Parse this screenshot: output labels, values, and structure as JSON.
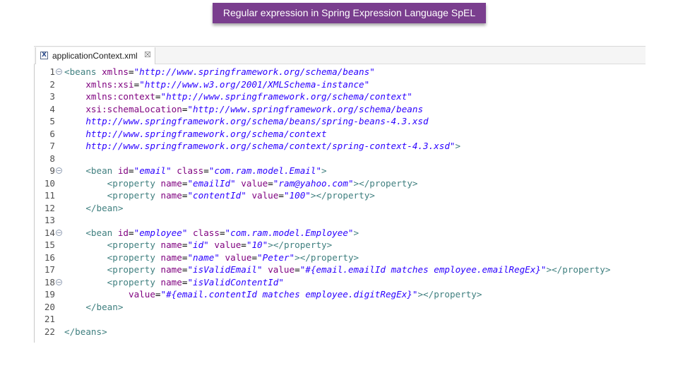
{
  "banner": {
    "title": "Regular expression in Spring Expression Language SpEL"
  },
  "tab": {
    "label": "applicationContext.xml",
    "close": "☒",
    "file_icon": "xml-file-icon"
  },
  "colors": {
    "banner": "#7a3e8e",
    "tag": "#3f7f7f",
    "attr": "#7f007f",
    "value": "#2a00ff"
  },
  "lines": [
    {
      "n": "1",
      "fold": true,
      "tokens": [
        {
          "c": "tag",
          "t": "<beans "
        },
        {
          "c": "attr",
          "t": "xmlns"
        },
        {
          "c": "eq",
          "t": "="
        },
        {
          "c": "val",
          "t": "\"http://www.springframework.org/schema/beans\""
        }
      ]
    },
    {
      "n": "2",
      "tokens": [
        {
          "c": "eq",
          "t": "    "
        },
        {
          "c": "attr",
          "t": "xmlns:xsi"
        },
        {
          "c": "eq",
          "t": "="
        },
        {
          "c": "val",
          "t": "\"http://www.w3.org/2001/XMLSchema-instance\""
        }
      ]
    },
    {
      "n": "3",
      "tokens": [
        {
          "c": "eq",
          "t": "    "
        },
        {
          "c": "attr",
          "t": "xmlns:context"
        },
        {
          "c": "eq",
          "t": "="
        },
        {
          "c": "val",
          "t": "\"http://www.springframework.org/schema/context\""
        }
      ]
    },
    {
      "n": "4",
      "tokens": [
        {
          "c": "eq",
          "t": "    "
        },
        {
          "c": "attr",
          "t": "xsi:schemaLocation"
        },
        {
          "c": "eq",
          "t": "="
        },
        {
          "c": "val",
          "t": "\"http://www.springframework.org/schema/beans"
        }
      ]
    },
    {
      "n": "5",
      "tokens": [
        {
          "c": "val",
          "t": "    http://www.springframework.org/schema/beans/spring-beans-4.3.xsd"
        }
      ]
    },
    {
      "n": "6",
      "tokens": [
        {
          "c": "val",
          "t": "    http://www.springframework.org/schema/context"
        }
      ]
    },
    {
      "n": "7",
      "tokens": [
        {
          "c": "val",
          "t": "    http://www.springframework.org/schema/context/spring-context-4.3.xsd\""
        },
        {
          "c": "tag",
          "t": ">"
        }
      ]
    },
    {
      "n": "8",
      "tokens": []
    },
    {
      "n": "9",
      "fold": true,
      "tokens": [
        {
          "c": "eq",
          "t": "    "
        },
        {
          "c": "tag",
          "t": "<bean "
        },
        {
          "c": "attr",
          "t": "id"
        },
        {
          "c": "eq",
          "t": "="
        },
        {
          "c": "val",
          "t": "\"email\""
        },
        {
          "c": "eq",
          "t": " "
        },
        {
          "c": "attr",
          "t": "class"
        },
        {
          "c": "eq",
          "t": "="
        },
        {
          "c": "val",
          "t": "\"com.ram.model.Email\""
        },
        {
          "c": "tag",
          "t": ">"
        }
      ]
    },
    {
      "n": "10",
      "tokens": [
        {
          "c": "eq",
          "t": "        "
        },
        {
          "c": "tag",
          "t": "<property "
        },
        {
          "c": "attr",
          "t": "name"
        },
        {
          "c": "eq",
          "t": "="
        },
        {
          "c": "val",
          "t": "\"emailId\""
        },
        {
          "c": "eq",
          "t": " "
        },
        {
          "c": "attr",
          "t": "value"
        },
        {
          "c": "eq",
          "t": "="
        },
        {
          "c": "val",
          "t": "\"ram@yahoo.com\""
        },
        {
          "c": "tag",
          "t": "></property>"
        }
      ]
    },
    {
      "n": "11",
      "tokens": [
        {
          "c": "eq",
          "t": "        "
        },
        {
          "c": "tag",
          "t": "<property "
        },
        {
          "c": "attr",
          "t": "name"
        },
        {
          "c": "eq",
          "t": "="
        },
        {
          "c": "val",
          "t": "\"contentId\""
        },
        {
          "c": "eq",
          "t": " "
        },
        {
          "c": "attr",
          "t": "value"
        },
        {
          "c": "eq",
          "t": "="
        },
        {
          "c": "val",
          "t": "\"100\""
        },
        {
          "c": "tag",
          "t": "></property>"
        }
      ]
    },
    {
      "n": "12",
      "tokens": [
        {
          "c": "eq",
          "t": "    "
        },
        {
          "c": "tag",
          "t": "</bean>"
        }
      ]
    },
    {
      "n": "13",
      "tokens": []
    },
    {
      "n": "14",
      "fold": true,
      "tokens": [
        {
          "c": "eq",
          "t": "    "
        },
        {
          "c": "tag",
          "t": "<bean "
        },
        {
          "c": "attr",
          "t": "id"
        },
        {
          "c": "eq",
          "t": "="
        },
        {
          "c": "val",
          "t": "\"employee\""
        },
        {
          "c": "eq",
          "t": " "
        },
        {
          "c": "attr",
          "t": "class"
        },
        {
          "c": "eq",
          "t": "="
        },
        {
          "c": "val",
          "t": "\"com.ram.model.Employee\""
        },
        {
          "c": "tag",
          "t": ">"
        }
      ]
    },
    {
      "n": "15",
      "tokens": [
        {
          "c": "eq",
          "t": "        "
        },
        {
          "c": "tag",
          "t": "<property "
        },
        {
          "c": "attr",
          "t": "name"
        },
        {
          "c": "eq",
          "t": "="
        },
        {
          "c": "val",
          "t": "\"id\""
        },
        {
          "c": "eq",
          "t": " "
        },
        {
          "c": "attr",
          "t": "value"
        },
        {
          "c": "eq",
          "t": "="
        },
        {
          "c": "val",
          "t": "\"10\""
        },
        {
          "c": "tag",
          "t": "></property>"
        }
      ]
    },
    {
      "n": "16",
      "tokens": [
        {
          "c": "eq",
          "t": "        "
        },
        {
          "c": "tag",
          "t": "<property "
        },
        {
          "c": "attr",
          "t": "name"
        },
        {
          "c": "eq",
          "t": "="
        },
        {
          "c": "val",
          "t": "\"name\""
        },
        {
          "c": "eq",
          "t": " "
        },
        {
          "c": "attr",
          "t": "value"
        },
        {
          "c": "eq",
          "t": "="
        },
        {
          "c": "val",
          "t": "\"Peter\""
        },
        {
          "c": "tag",
          "t": "></property>"
        }
      ]
    },
    {
      "n": "17",
      "tokens": [
        {
          "c": "eq",
          "t": "        "
        },
        {
          "c": "tag",
          "t": "<property "
        },
        {
          "c": "attr",
          "t": "name"
        },
        {
          "c": "eq",
          "t": "="
        },
        {
          "c": "val",
          "t": "\"isValidEmail\""
        },
        {
          "c": "eq",
          "t": " "
        },
        {
          "c": "attr",
          "t": "value"
        },
        {
          "c": "eq",
          "t": "="
        },
        {
          "c": "val",
          "t": "\"#{email.emailId matches employee.emailRegEx}\""
        },
        {
          "c": "tag",
          "t": "></property>"
        }
      ]
    },
    {
      "n": "18",
      "fold": true,
      "tokens": [
        {
          "c": "eq",
          "t": "        "
        },
        {
          "c": "tag",
          "t": "<property "
        },
        {
          "c": "attr",
          "t": "name"
        },
        {
          "c": "eq",
          "t": "="
        },
        {
          "c": "val",
          "t": "\"isValidContentId\""
        }
      ]
    },
    {
      "n": "19",
      "tokens": [
        {
          "c": "eq",
          "t": "            "
        },
        {
          "c": "attr",
          "t": "value"
        },
        {
          "c": "eq",
          "t": "="
        },
        {
          "c": "val",
          "t": "\"#{email.contentId matches employee.digitRegEx}\""
        },
        {
          "c": "tag",
          "t": "></property>"
        }
      ]
    },
    {
      "n": "20",
      "tokens": [
        {
          "c": "eq",
          "t": "    "
        },
        {
          "c": "tag",
          "t": "</bean>"
        }
      ]
    },
    {
      "n": "21",
      "tokens": []
    },
    {
      "n": "22",
      "tokens": [
        {
          "c": "tag",
          "t": "</beans>"
        }
      ]
    }
  ]
}
